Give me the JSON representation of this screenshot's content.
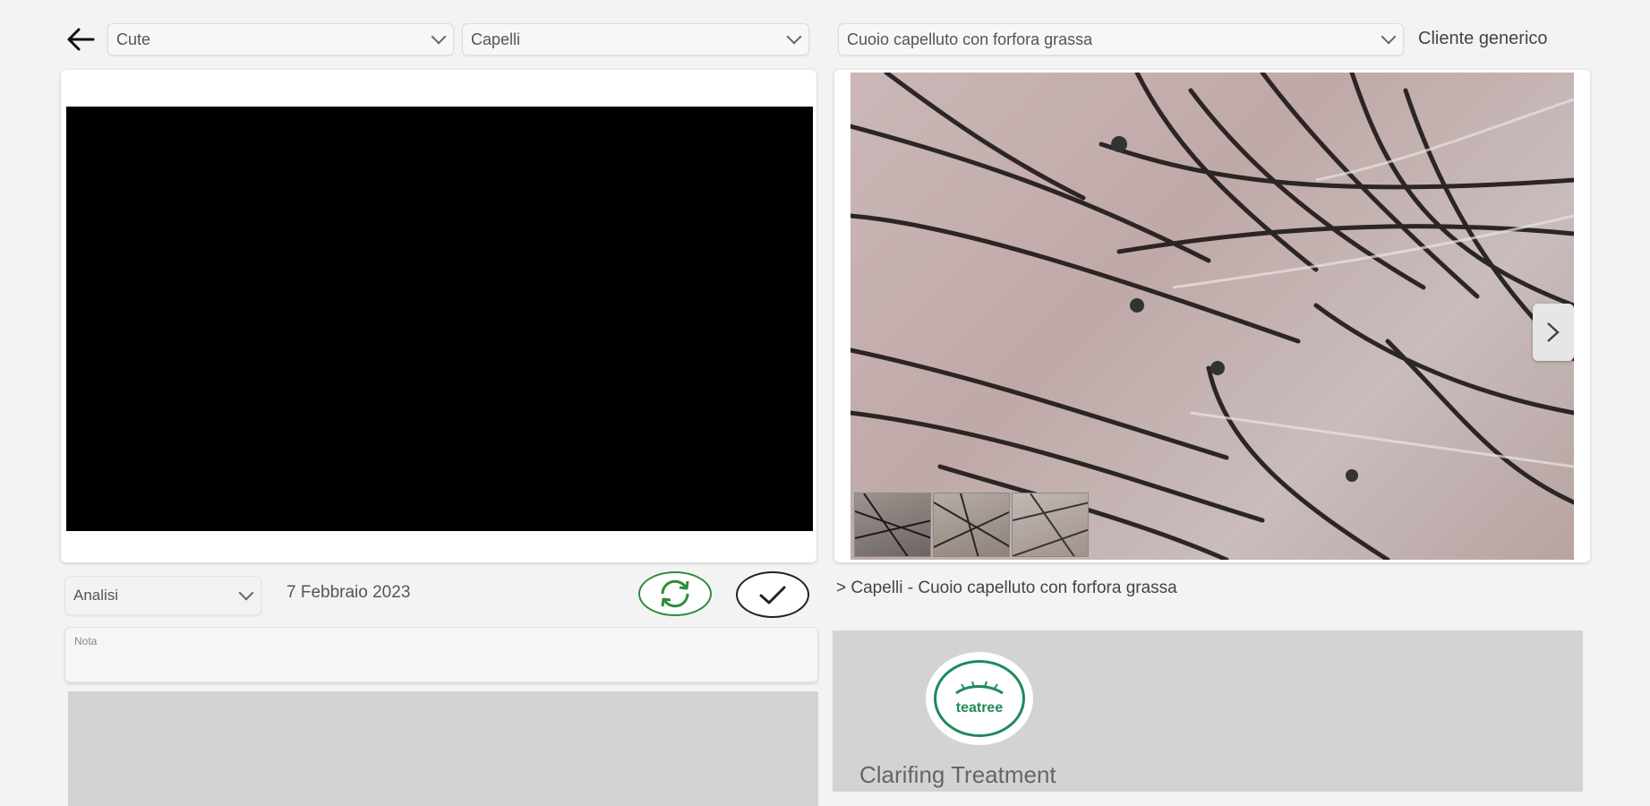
{
  "toolbar": {
    "back_icon": "arrow-left-icon",
    "select_area": "Cute",
    "select_type": "Capelli",
    "select_condition": "Cuoio capelluto con forfora grassa",
    "client": "Cliente generico"
  },
  "left": {
    "analysis_select": "Analisi",
    "date": "7 Febbraio 2023",
    "refresh_icon": "refresh-icon",
    "confirm_icon": "check-icon",
    "note_label": "Nota",
    "refresh_color": "#2e8b3a"
  },
  "right": {
    "next_icon": "chevron-right-icon",
    "breadcrumb": "> Capelli - Cuoio capelluto con forfora grassa",
    "product_logo_text": "teatree",
    "product_name": "Clarifing Treatment",
    "logo_color": "#1f8a5a"
  }
}
